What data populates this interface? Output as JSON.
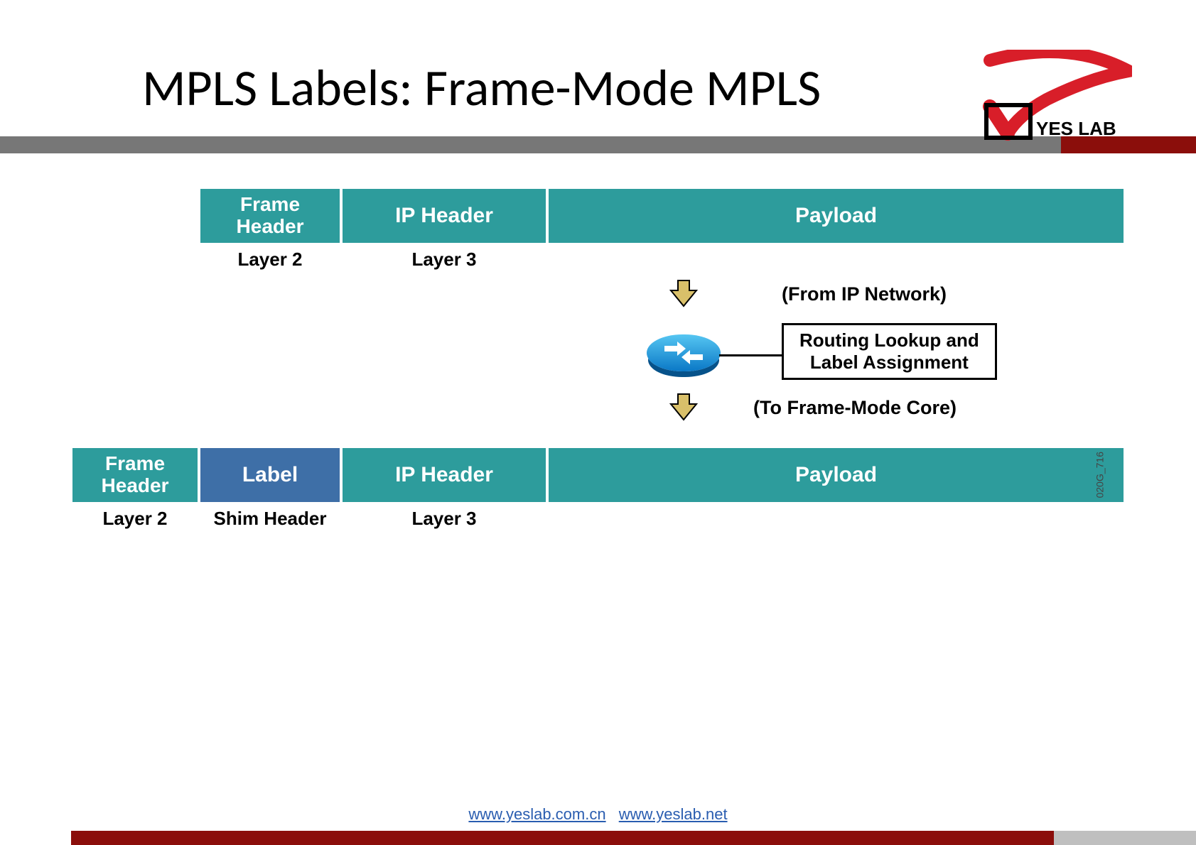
{
  "title": "MPLS Labels: Frame-Mode MPLS",
  "logo_text": "YES LAB",
  "packet_top": {
    "frame_header": "Frame Header",
    "ip_header": "IP Header",
    "payload": "Payload",
    "layer2": "Layer 2",
    "layer3": "Layer 3"
  },
  "middle": {
    "from": "(From IP Network)",
    "lookup_l1": "Routing Lookup and",
    "lookup_l2": "Label Assignment",
    "to": "(To Frame-Mode Core)"
  },
  "packet_bottom": {
    "frame_header": "Frame Header",
    "label": "Label",
    "ip_header": "IP Header",
    "payload": "Payload",
    "layer2": "Layer 2",
    "shim": "Shim Header",
    "layer3": "Layer 3"
  },
  "image_code": "020G_716",
  "footer": {
    "link1_text": "www.yeslab.com.cn",
    "link2_text": "www.yeslab.net"
  }
}
